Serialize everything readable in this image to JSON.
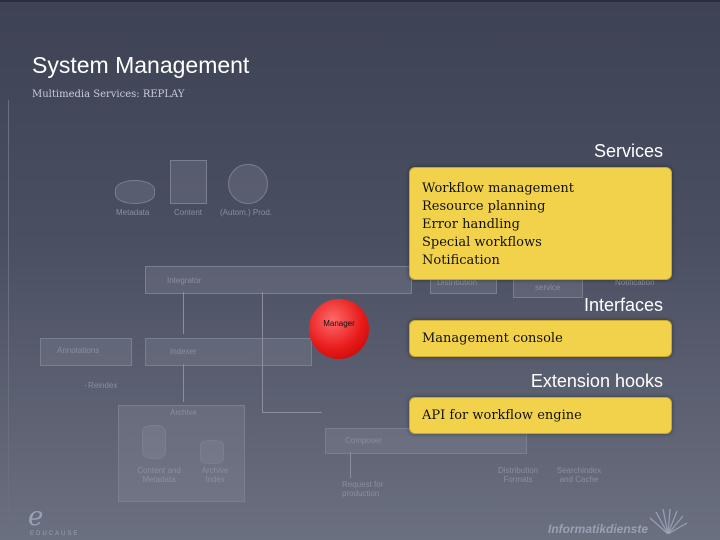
{
  "slide": {
    "title": "System Management",
    "subtitle": "Multimedia Services: REPLAY"
  },
  "diagram": {
    "sources": [
      "Metadata",
      "Content",
      "(Autom.) Prod."
    ],
    "integrator": "Integrator",
    "manager": "Manager",
    "annotations": "Annotations",
    "indexer": "Indexer",
    "reindex": "Reindex",
    "archive": "Archive",
    "content_and_metadata": "Content and Metadata",
    "archive_index": "Archive Index",
    "composer": "Composer",
    "request": "Request for production",
    "distribution_formats": "Distribution Formats",
    "search_caches": "Searchindex and Cache",
    "distribution_top": "Distribution",
    "service": "service",
    "notification_top": "Notification"
  },
  "panels": {
    "services": {
      "label": "Services",
      "items": [
        "Workflow management",
        "Resource planning",
        "Error handling",
        "Special workflows",
        "Notification"
      ]
    },
    "interfaces": {
      "label": "Interfaces",
      "items": [
        "Management console"
      ]
    },
    "extension_hooks": {
      "label": "Extension hooks",
      "items": [
        "API for workflow engine"
      ]
    }
  },
  "footer": {
    "logo_letter": "e",
    "logo_text": "EDUCAUSE",
    "right_text": "Informatikdienste"
  },
  "colors": {
    "panel_yellow": "#f2d24a",
    "manager_red": "#e81a1a",
    "background": "#4a4f62"
  }
}
